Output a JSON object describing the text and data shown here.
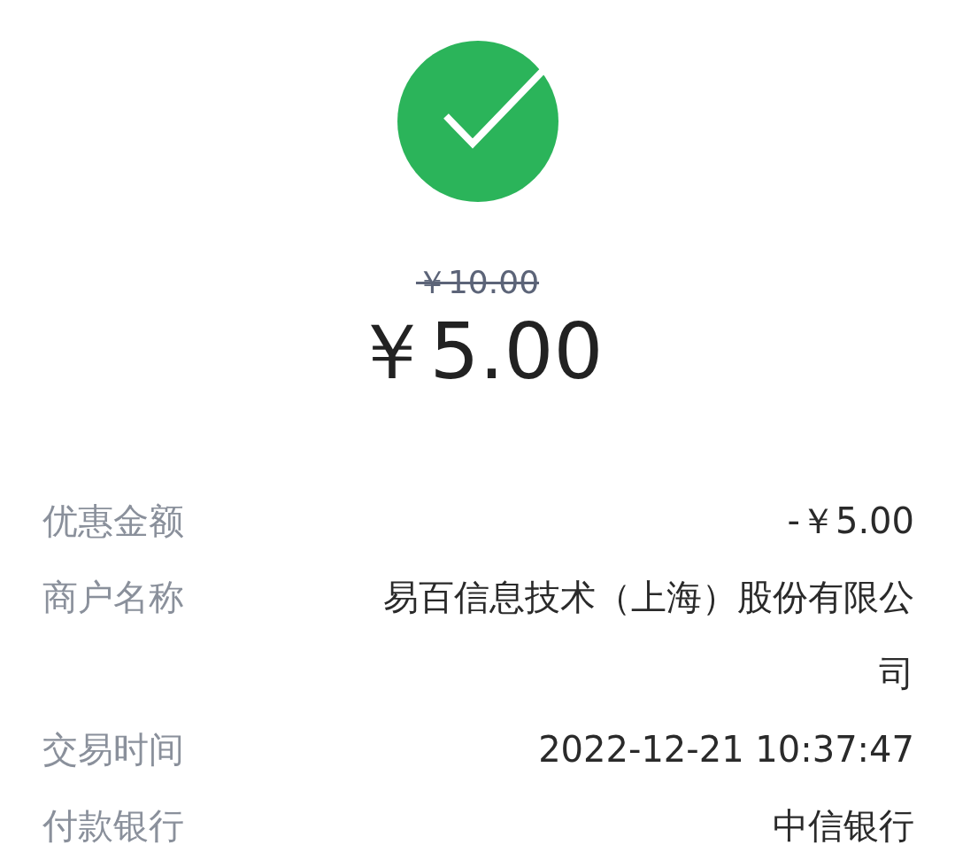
{
  "original_price": "￥10.00",
  "amount": "￥5.00",
  "details": [
    {
      "label": "优惠金额",
      "value": "-￥5.00"
    },
    {
      "label": "商户名称",
      "value": "易百信息技术（上海）股份有限公司"
    },
    {
      "label": "交易时间",
      "value": "2022-12-21 10:37:47"
    },
    {
      "label": "付款银行",
      "value": "中信银行"
    }
  ]
}
